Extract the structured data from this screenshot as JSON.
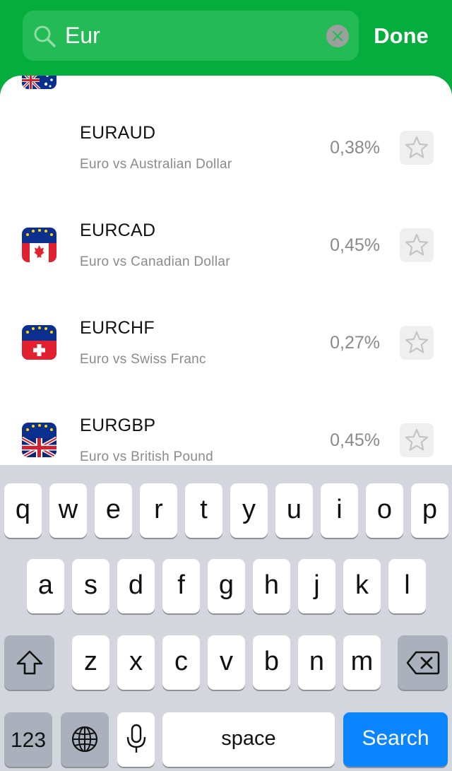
{
  "search": {
    "query": "Eur",
    "done_label": "Done"
  },
  "list": [
    {
      "symbol": "EURAUD",
      "description": "Euro vs Australian Dollar",
      "percent": "0,38%"
    },
    {
      "symbol": "EURCAD",
      "description": "Euro vs Canadian Dollar",
      "percent": "0,45%"
    },
    {
      "symbol": "EURCHF",
      "description": "Euro vs Swiss Franc",
      "percent": "0,27%"
    },
    {
      "symbol": "EURGBP",
      "description": "Euro vs British Pound",
      "percent": "0,45%"
    }
  ],
  "keyboard": {
    "row1": [
      "q",
      "w",
      "e",
      "r",
      "t",
      "y",
      "u",
      "i",
      "o",
      "p"
    ],
    "row2": [
      "a",
      "s",
      "d",
      "f",
      "g",
      "h",
      "j",
      "k",
      "l"
    ],
    "row3": [
      "z",
      "x",
      "c",
      "v",
      "b",
      "n",
      "m"
    ],
    "numbers_label": "123",
    "space_label": "space",
    "search_label": "Search"
  },
  "colors": {
    "header_green": "#04ad3c",
    "search_blue": "#0a84ff"
  }
}
